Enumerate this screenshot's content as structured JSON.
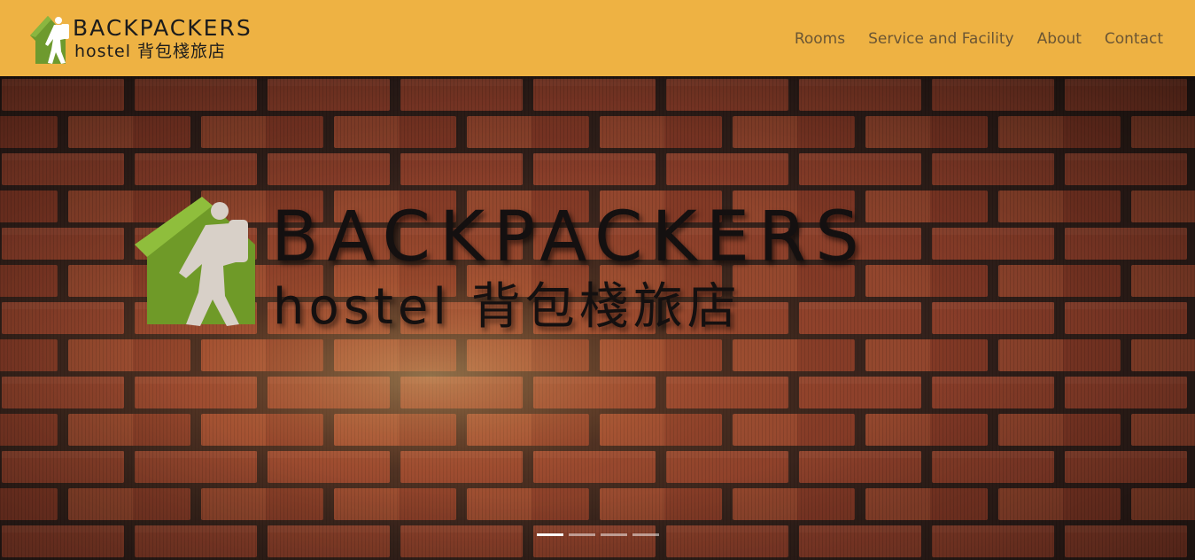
{
  "header": {
    "logo": {
      "title": "BACKPACKERS",
      "subtitle": "hostel 背包棧旅店"
    },
    "nav": [
      {
        "label": "Rooms"
      },
      {
        "label": "Service and Facility"
      },
      {
        "label": "About"
      },
      {
        "label": "Contact"
      }
    ]
  },
  "hero": {
    "sign_title": "BACKPACKERS",
    "sign_subtitle": "hostel 背包棧旅店",
    "carousel": {
      "slide_count": 4,
      "active_index": 0
    }
  },
  "colors": {
    "header_bg": "#eeb243",
    "nav_text": "#6b5634",
    "logo_green": "#6e9a2e",
    "brick": "#a54a32",
    "mortar": "#3a2620"
  }
}
